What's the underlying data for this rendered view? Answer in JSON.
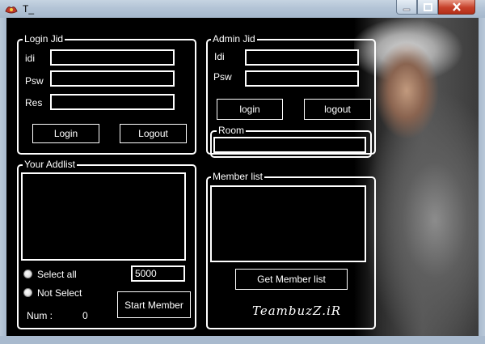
{
  "window": {
    "title": "T_"
  },
  "login_jid": {
    "title": "Login Jid",
    "id_label": "idi",
    "psw_label": "Psw",
    "res_label": "Res",
    "login_button": "Login",
    "logout_button": "Logout"
  },
  "admin_jid": {
    "title": "Admin Jid",
    "id_label": "Idi",
    "psw_label": "Psw",
    "login_button": "login",
    "logout_button": "logout",
    "room_title": "Room"
  },
  "addlist": {
    "title": "Your Addlist",
    "select_all": "Select all",
    "not_select": "Not Select",
    "count_value": "5000",
    "num_label": "Num :",
    "num_value": "0",
    "start_button": "Start Member"
  },
  "member_list": {
    "title": "Member list",
    "get_button": "Get Member list"
  },
  "signature": "TeambuzZ.iR"
}
